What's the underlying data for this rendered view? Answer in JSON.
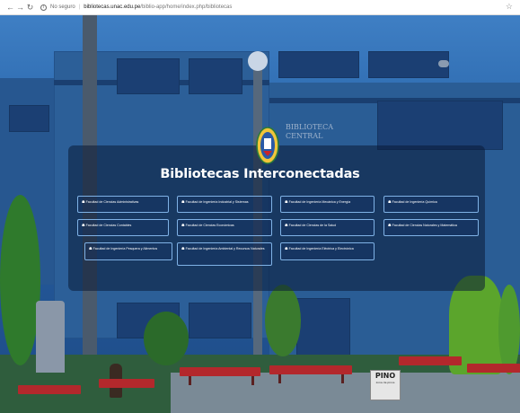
{
  "browser": {
    "nav_icons": [
      "back-arrow-icon",
      "forward-arrow-icon",
      "reload-icon"
    ],
    "security_label": "No seguro",
    "url_host": "bibliotecas.unac.edu.pe",
    "url_path": "/biblio-app/home/index.php/bibliotecas",
    "bookmark_icon": "star-icon"
  },
  "page": {
    "title": "Bibliotecas Interconectadas",
    "sign_text": [
      "BIBLIOTECA",
      "CENTRAL"
    ],
    "pino_sign": {
      "big": "PINO",
      "small": "zona de pinos"
    },
    "logo_icon": "university-shield-logo"
  },
  "faculties": [
    {
      "label": "Facultad de Ciencias Administrativas",
      "icon": "building-icon"
    },
    {
      "label": "Facultad de Ingeniería Industrial y Sistemas",
      "icon": "building-icon"
    },
    {
      "label": "Facultad de Ingeniería Mecánica y Energía",
      "icon": "building-icon"
    },
    {
      "label": "Facultad de Ingeniería Química",
      "icon": "building-icon"
    },
    {
      "label": "Facultad de Ciencias Contables",
      "icon": "building-icon"
    },
    {
      "label": "Facultad de Ciencias Económicas",
      "icon": "building-icon"
    },
    {
      "label": "Facultad de Ciencias de la Salud",
      "icon": "building-icon"
    },
    {
      "label": "Facultad de Ciencias Naturales y Matemática",
      "icon": "building-icon"
    },
    {
      "label": "Facultad de Ingeniería Pesquera y Alimentos",
      "icon": "building-icon"
    },
    {
      "label": "Facultad de Ingeniería Ambiental y Recursos Naturales",
      "icon": "building-icon"
    },
    {
      "label": "Facultad de Ingeniería Eléctrica y Electrónica",
      "icon": "building-icon"
    }
  ],
  "colors": {
    "button_border": "#7fb2e6",
    "title_text": "#ffffff",
    "overlay": "rgba(10,25,55,0.55)"
  }
}
